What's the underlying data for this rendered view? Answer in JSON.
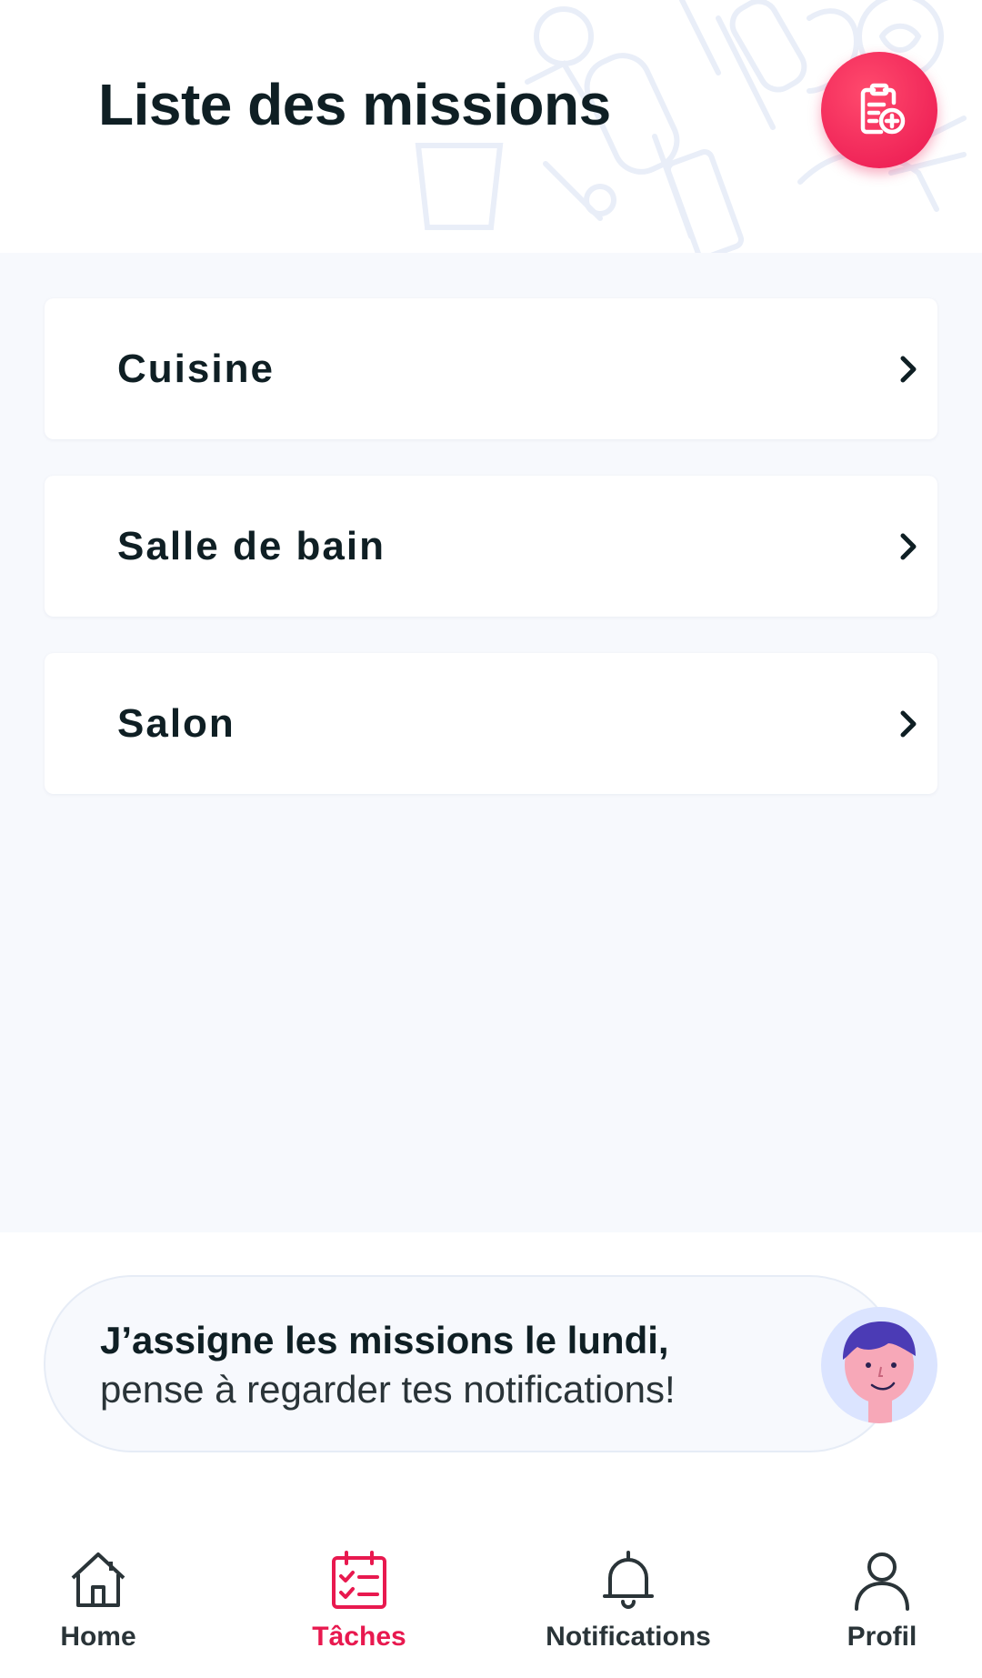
{
  "header": {
    "title": "Liste des missions",
    "add_button_icon": "clipboard-add-icon"
  },
  "missions": [
    {
      "label": "Cuisine"
    },
    {
      "label": "Salle de bain"
    },
    {
      "label": "Salon"
    }
  ],
  "tip": {
    "line1": "J’assigne les missions le lundi,",
    "line2": "pense à regarder tes notifications!",
    "avatar_icon": "boy-avatar"
  },
  "tabbar": {
    "items": [
      {
        "label": "Home",
        "icon": "home-icon",
        "active": false
      },
      {
        "label": "Tâches",
        "icon": "calendar-checklist-icon",
        "active": true
      },
      {
        "label": "Notifications",
        "icon": "bell-icon",
        "active": false
      },
      {
        "label": "Profil",
        "icon": "user-icon",
        "active": false
      }
    ]
  },
  "colors": {
    "accent": "#e8194f",
    "text_dark": "#0f1f24",
    "background": "#f7f9fd",
    "avatar_bg": "#dbe4ff"
  }
}
